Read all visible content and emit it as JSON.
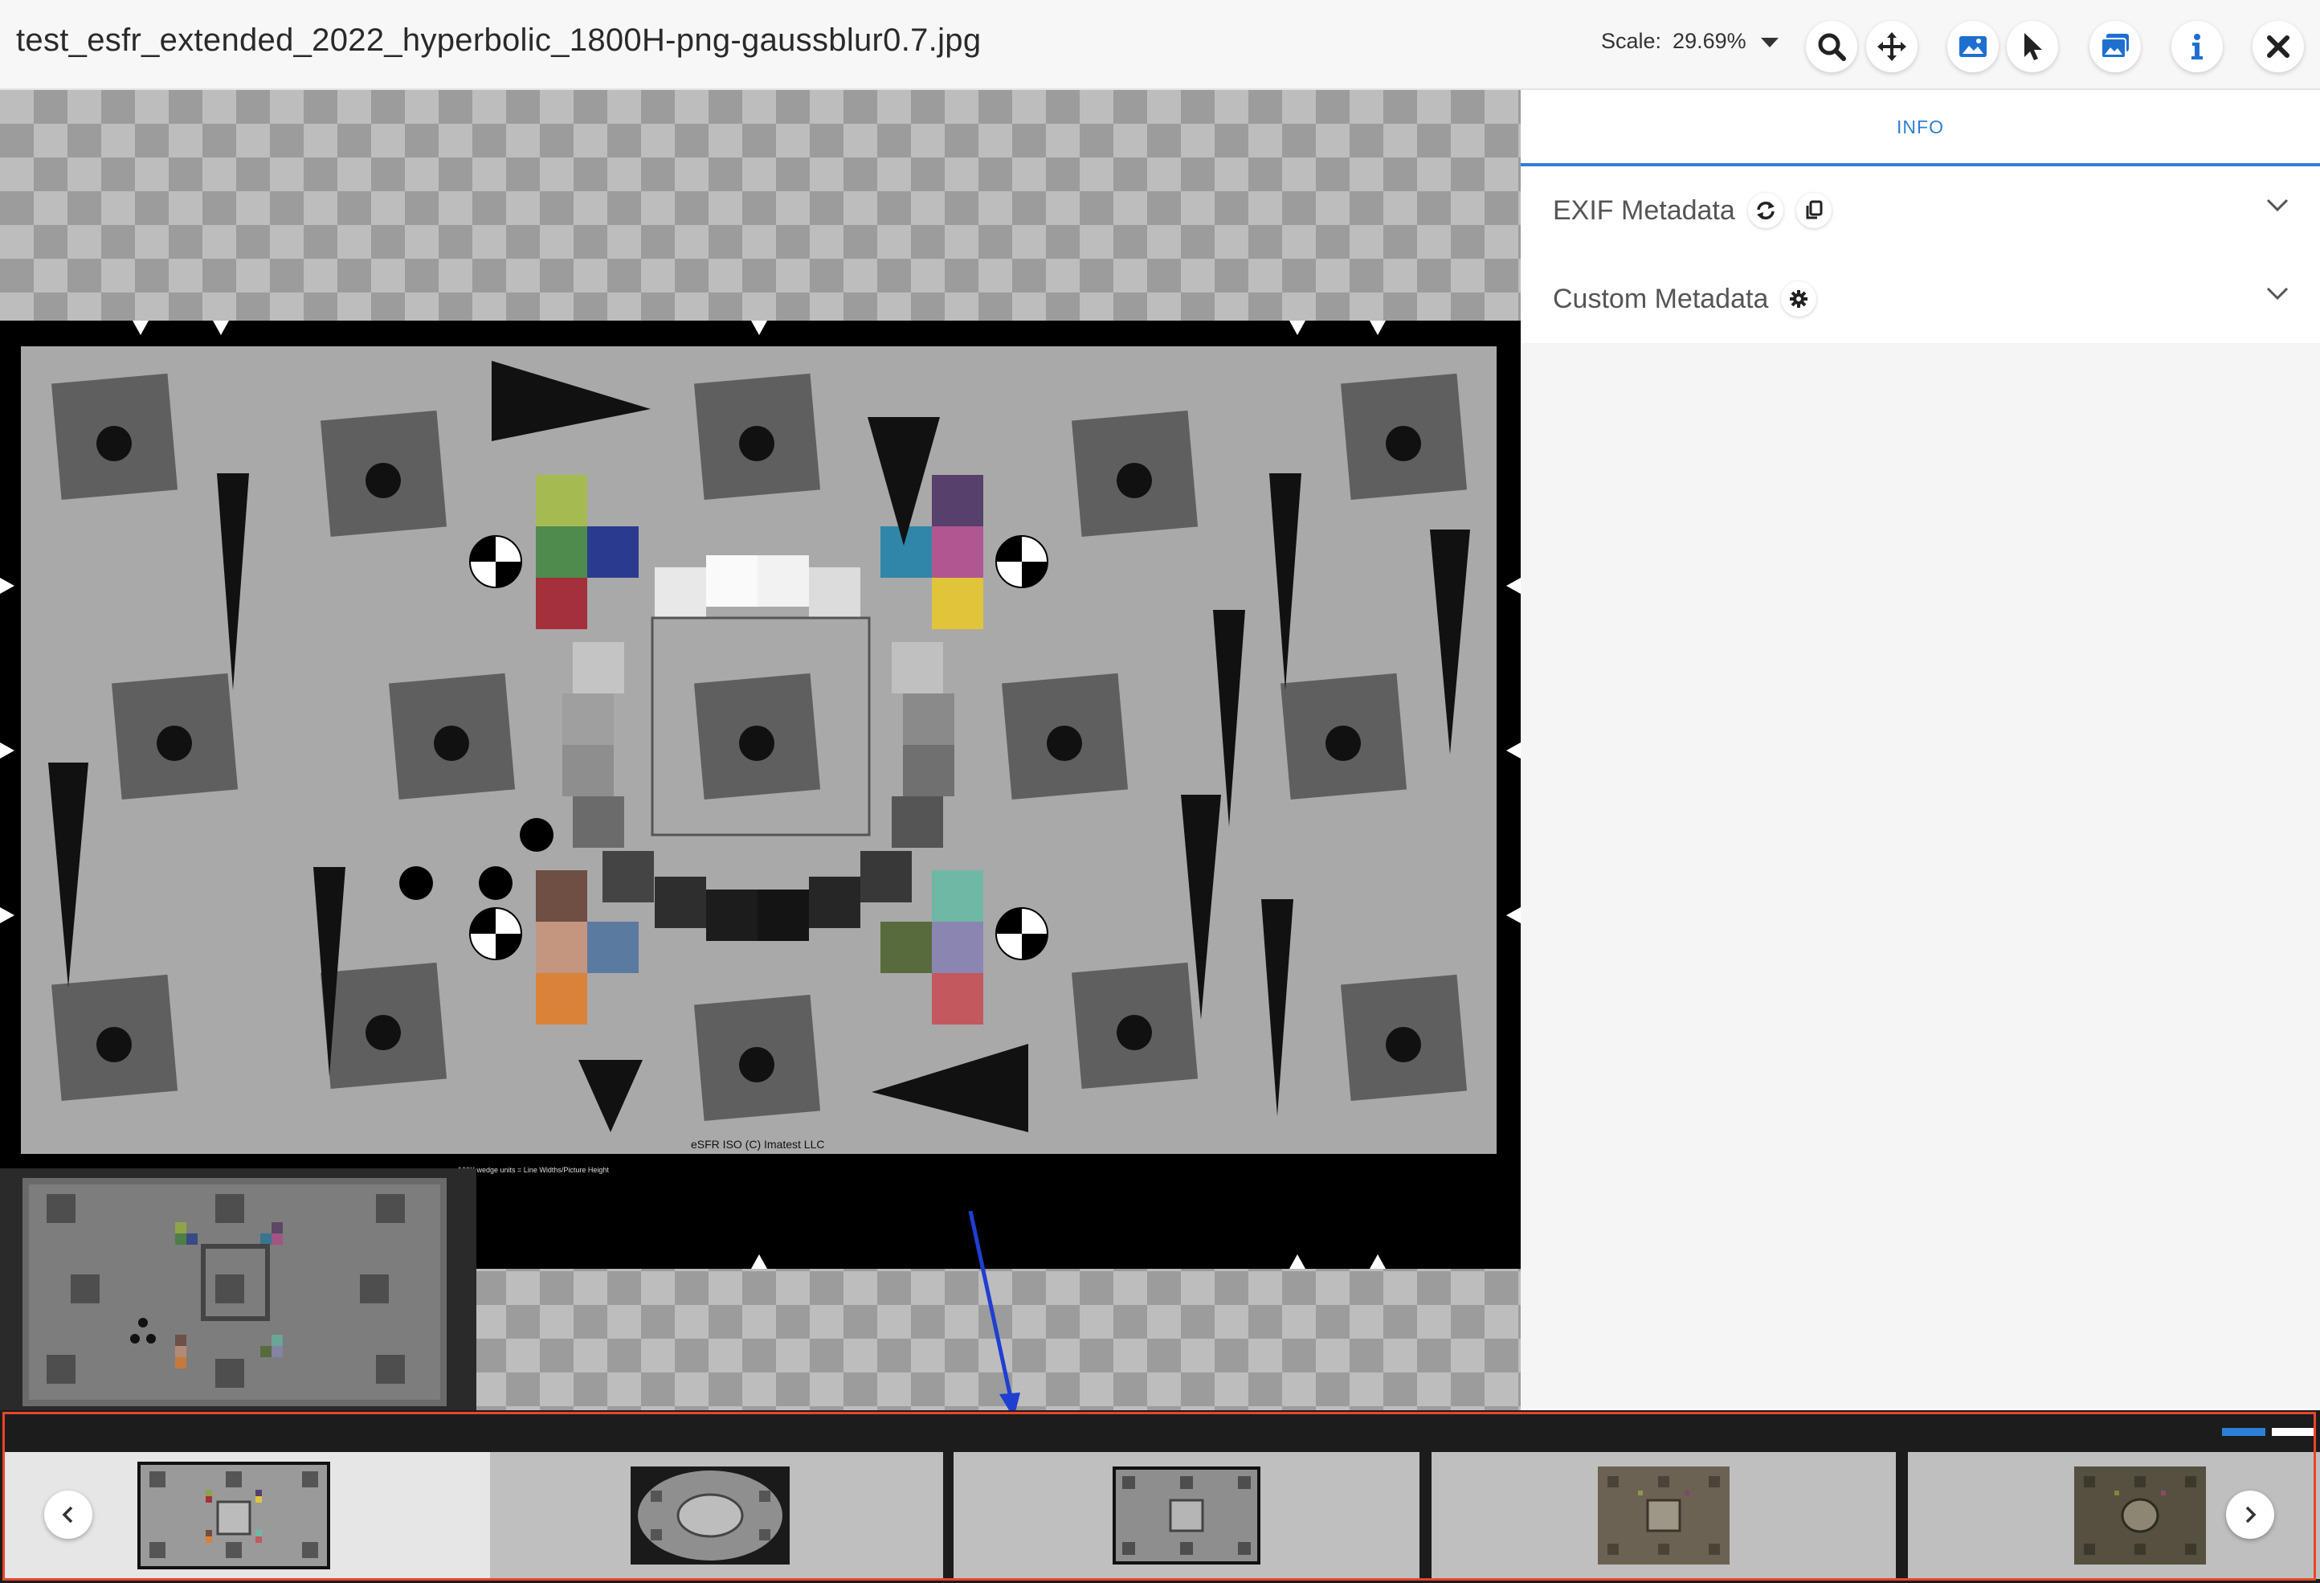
{
  "header": {
    "title": "test_esfr_extended_2022_hyperbolic_1800H-png-gaussblur0.7.jpg",
    "scale_label": "Scale:",
    "scale_value": "29.69%",
    "toolbar_icons": [
      "search-icon",
      "move-icon",
      "image-icon",
      "pointer-icon",
      "gallery-icon",
      "info-icon",
      "close-icon"
    ]
  },
  "viewer": {
    "chart_caption": "eSFR ISO (C) Imatest LLC",
    "chart_footnote": "100X wedge units = Line Widths/Picture Height"
  },
  "sidebar": {
    "tab_label": "INFO",
    "sections": [
      {
        "label": "EXIF Metadata",
        "icons": [
          "refresh-icon",
          "copy-icon"
        ]
      },
      {
        "label": "Custom Metadata",
        "icons": [
          "gear-icon"
        ]
      }
    ]
  },
  "filmstrip": {
    "active_index": 0,
    "thumbnails": [
      "thumbnail-1",
      "thumbnail-2",
      "thumbnail-3",
      "thumbnail-4",
      "thumbnail-5"
    ],
    "colors": {
      "highlight_border": "#e8452a",
      "accent": "#2e7fd6"
    }
  }
}
